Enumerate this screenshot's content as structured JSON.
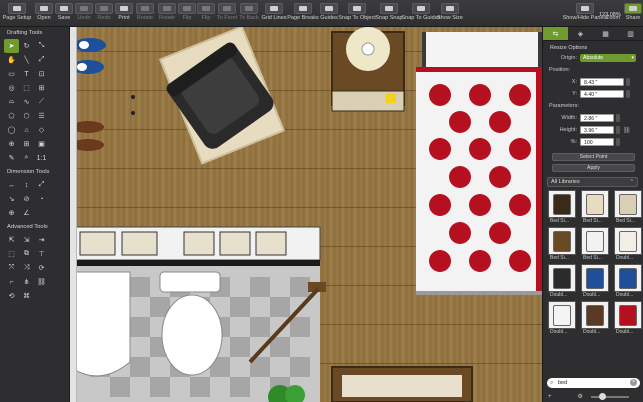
{
  "toolbar": [
    {
      "label": "Page Setup",
      "dim": false
    },
    {
      "label": "Open",
      "dim": false
    },
    {
      "label": "Save",
      "dim": false
    },
    {
      "label": "Undo",
      "dim": true
    },
    {
      "label": "Redo",
      "dim": true
    },
    {
      "label": "Print",
      "dim": false
    },
    {
      "label": "Rotate",
      "dim": true
    },
    {
      "label": "Rotate",
      "dim": true
    },
    {
      "label": "Flip",
      "dim": true
    },
    {
      "label": "Flip",
      "dim": true
    },
    {
      "label": "To Front",
      "dim": true
    },
    {
      "label": "To Back",
      "dim": true
    },
    {
      "label": "Grid Lines",
      "dim": false
    },
    {
      "label": "Page Breaks",
      "dim": false
    },
    {
      "label": "Guides",
      "dim": false
    },
    {
      "label": "Snap To Object",
      "dim": false
    },
    {
      "label": "Snap Snap",
      "dim": false
    },
    {
      "label": "Snap To Guides",
      "dim": false
    },
    {
      "label": "Show Size",
      "dim": false
    },
    {
      "label": "Show/Hide Panels",
      "dim": false
    },
    {
      "label": "Zoom",
      "dim": false
    },
    {
      "label": "Share",
      "dim": false
    }
  ],
  "zoom_value": "123.08%",
  "left_panel": {
    "drafting_title": "Drafting Tools",
    "dimension_title": "Dimension Tools",
    "advanced_title": "Advanced Tools",
    "scale_label": "1:1"
  },
  "right_panel": {
    "section_title": "Resize Options",
    "origin_label": "Origin:",
    "origin_value": "Absolute",
    "position_label": "Position:",
    "x_label": "X:",
    "x_value": "8.43 \"",
    "y_label": "Y:",
    "y_value": "4.40 \"",
    "parameters_label": "Parameters:",
    "width_label": "Width:",
    "width_value": "2.86 \"",
    "height_label": "Height:",
    "height_value": "3.96 \"",
    "percent_label": "%:",
    "percent_value": "100",
    "select_point_label": "Select Point",
    "apply_label": "Apply",
    "library_selector": "All Libraries",
    "library_items": [
      "Bed Si...",
      "Bed Si...",
      "Bed Si...",
      "Bed Si...",
      "Bed Si...",
      "Doubl...",
      "Doubl...",
      "Doubl...",
      "Doubl...",
      "Doubl...",
      "Doubl...",
      "Doubl..."
    ],
    "search_value": "bed"
  },
  "colors": {
    "accent": "#6e9a2e",
    "panel": "#2e2e30",
    "floor": "#8f703f",
    "bed_red": "#c0192a"
  }
}
